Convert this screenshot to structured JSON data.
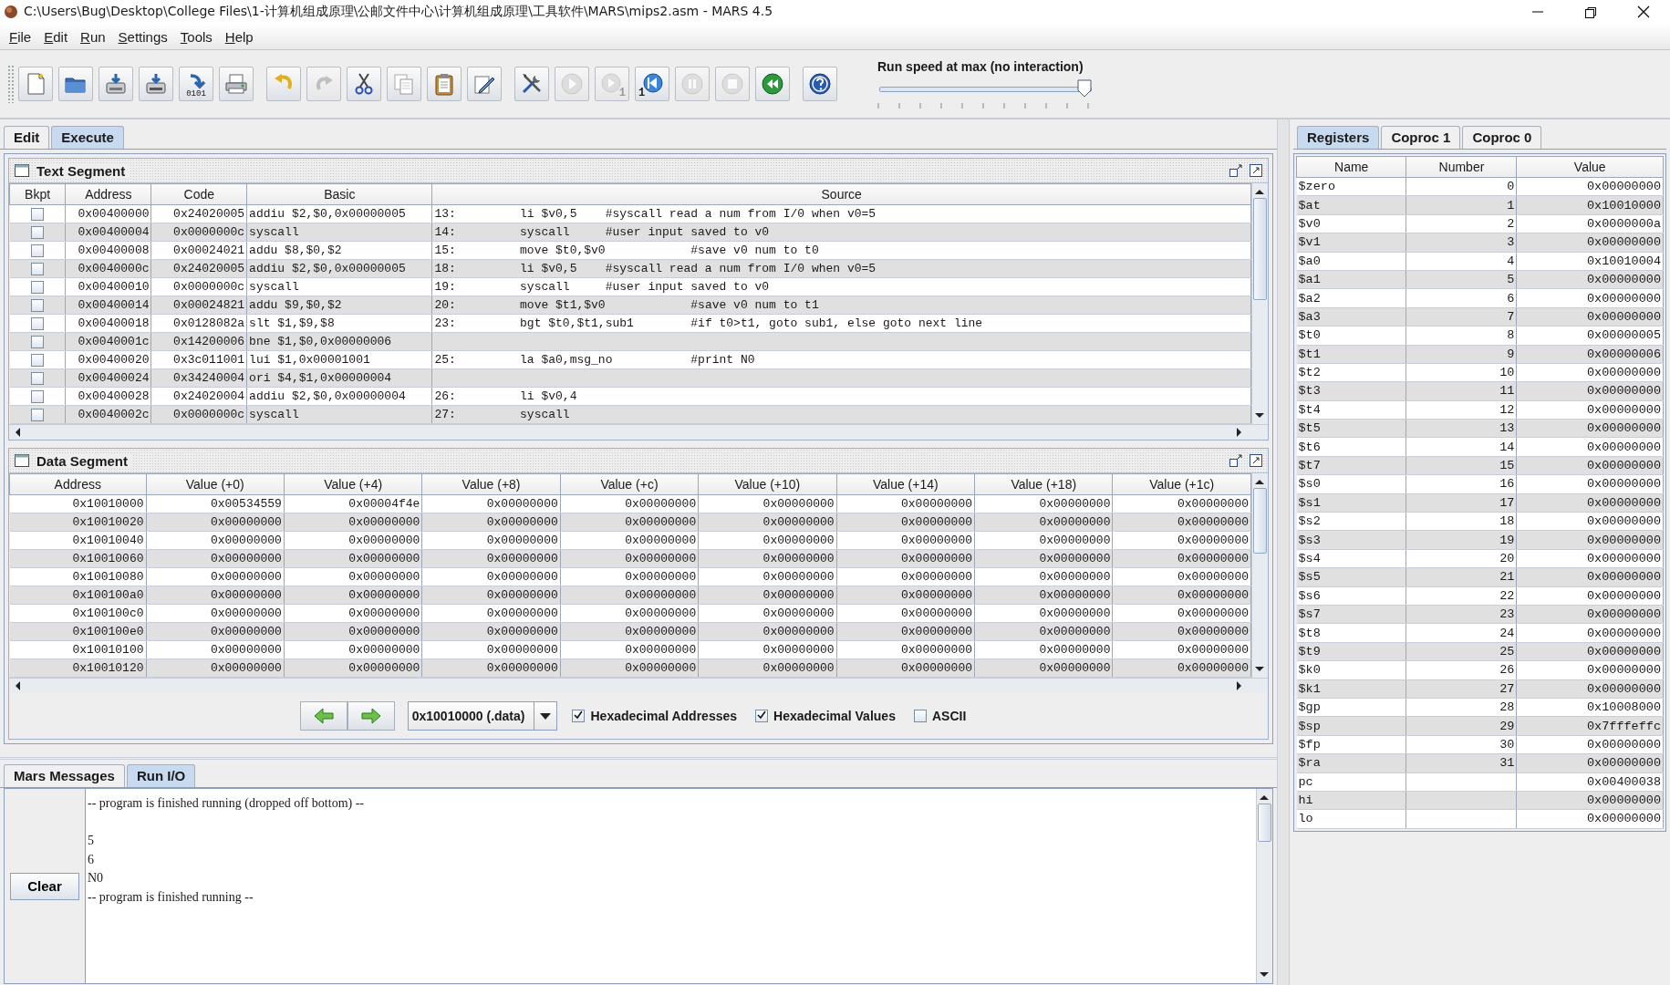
{
  "window": {
    "title": "C:\\Users\\Bug\\Desktop\\College Files\\1-计算机组成原理\\公邮文件中心\\计算机组成原理\\工具软件\\MARS\\mips2.asm  - MARS 4.5"
  },
  "menu": [
    "File",
    "Edit",
    "Run",
    "Settings",
    "Tools",
    "Help"
  ],
  "toolbar": [
    [
      {
        "kind": "new",
        "disabled": false
      },
      {
        "kind": "open",
        "disabled": false
      },
      {
        "kind": "save",
        "disabled": false
      },
      {
        "kind": "save_as",
        "disabled": false
      },
      {
        "kind": "dump",
        "disabled": false,
        "badge": "0101"
      },
      {
        "kind": "print",
        "disabled": false
      }
    ],
    [
      {
        "kind": "undo",
        "disabled": false
      },
      {
        "kind": "redo",
        "disabled": true
      },
      {
        "kind": "cut",
        "disabled": false
      },
      {
        "kind": "copy",
        "disabled": false
      },
      {
        "kind": "paste",
        "disabled": false
      },
      {
        "kind": "find",
        "disabled": false
      }
    ],
    [
      {
        "kind": "assemble",
        "disabled": false
      },
      {
        "kind": "run",
        "disabled": true
      },
      {
        "kind": "step",
        "disabled": true,
        "badge": "1"
      },
      {
        "kind": "backstep",
        "disabled": false,
        "badge": "1"
      },
      {
        "kind": "pause",
        "disabled": true
      },
      {
        "kind": "stop",
        "disabled": true
      },
      {
        "kind": "reset",
        "disabled": false
      }
    ],
    [
      {
        "kind": "help",
        "disabled": false
      }
    ]
  ],
  "run_speed": {
    "label": "Run speed at max (no interaction)",
    "level": 1
  },
  "main_tabs": [
    {
      "label": "Edit",
      "selected": false
    },
    {
      "label": "Execute",
      "selected": true
    }
  ],
  "text_segment": {
    "title": "Text Segment",
    "columns": [
      "Bkpt",
      "Address",
      "Code",
      "Basic",
      "Source"
    ],
    "rows": [
      {
        "bkpt": false,
        "address": "0x00400000",
        "code": "0x24020005",
        "basic": "addiu $2,$0,0x00000005",
        "source": "13:\tli $v0,5\t#syscall read a num from I/0 when v0=5"
      },
      {
        "bkpt": false,
        "address": "0x00400004",
        "code": "0x0000000c",
        "basic": "syscall",
        "source": "14:\tsyscall\t#user input saved to v0"
      },
      {
        "bkpt": false,
        "address": "0x00400008",
        "code": "0x00024021",
        "basic": "addu $8,$0,$2",
        "source": "15:\tmove $t0,$v0\t#save v0 num to t0"
      },
      {
        "bkpt": false,
        "address": "0x0040000c",
        "code": "0x24020005",
        "basic": "addiu $2,$0,0x00000005",
        "source": "18:\tli $v0,5\t#syscall read a num from I/0 when v0=5"
      },
      {
        "bkpt": false,
        "address": "0x00400010",
        "code": "0x0000000c",
        "basic": "syscall",
        "source": "19:\tsyscall\t#user input saved to v0"
      },
      {
        "bkpt": false,
        "address": "0x00400014",
        "code": "0x00024821",
        "basic": "addu $9,$0,$2",
        "source": "20:\tmove $t1,$v0\t#save v0 num to t1"
      },
      {
        "bkpt": false,
        "address": "0x00400018",
        "code": "0x0128082a",
        "basic": "slt $1,$9,$8",
        "source": "23:\tbgt $t0,$t1,sub1\t#if t0>t1, goto sub1, else goto next line"
      },
      {
        "bkpt": false,
        "address": "0x0040001c",
        "code": "0x14200006",
        "basic": "bne $1,$0,0x00000006"
      },
      {
        "bkpt": false,
        "address": "0x00400020",
        "code": "0x3c011001",
        "basic": "lui $1,0x00001001",
        "source": "25:\tla $a0,msg_no\t#print N0"
      },
      {
        "bkpt": false,
        "address": "0x00400024",
        "code": "0x34240004",
        "basic": "ori $4,$1,0x00000004"
      },
      {
        "bkpt": false,
        "address": "0x00400028",
        "code": "0x24020004",
        "basic": "addiu $2,$0,0x00000004",
        "source": "26:\tli $v0,4"
      },
      {
        "bkpt": false,
        "address": "0x0040002c",
        "code": "0x0000000c",
        "basic": "syscall",
        "source": "27:\tsyscall"
      }
    ]
  },
  "data_segment": {
    "title": "Data Segment",
    "columns": [
      "Address",
      "Value (+0)",
      "Value (+4)",
      "Value (+8)",
      "Value (+c)",
      "Value (+10)",
      "Value (+14)",
      "Value (+18)",
      "Value (+1c)"
    ],
    "rows": [
      {
        "address": "0x10010000",
        "values": [
          "0x00534559",
          "0x00004f4e",
          "0x00000000",
          "0x00000000",
          "0x00000000",
          "0x00000000",
          "0x00000000",
          "0x00000000"
        ]
      },
      {
        "address": "0x10010020",
        "values": [
          "0x00000000",
          "0x00000000",
          "0x00000000",
          "0x00000000",
          "0x00000000",
          "0x00000000",
          "0x00000000",
          "0x00000000"
        ]
      },
      {
        "address": "0x10010040",
        "values": [
          "0x00000000",
          "0x00000000",
          "0x00000000",
          "0x00000000",
          "0x00000000",
          "0x00000000",
          "0x00000000",
          "0x00000000"
        ]
      },
      {
        "address": "0x10010060",
        "values": [
          "0x00000000",
          "0x00000000",
          "0x00000000",
          "0x00000000",
          "0x00000000",
          "0x00000000",
          "0x00000000",
          "0x00000000"
        ]
      },
      {
        "address": "0x10010080",
        "values": [
          "0x00000000",
          "0x00000000",
          "0x00000000",
          "0x00000000",
          "0x00000000",
          "0x00000000",
          "0x00000000",
          "0x00000000"
        ]
      },
      {
        "address": "0x100100a0",
        "values": [
          "0x00000000",
          "0x00000000",
          "0x00000000",
          "0x00000000",
          "0x00000000",
          "0x00000000",
          "0x00000000",
          "0x00000000"
        ]
      },
      {
        "address": "0x100100c0",
        "values": [
          "0x00000000",
          "0x00000000",
          "0x00000000",
          "0x00000000",
          "0x00000000",
          "0x00000000",
          "0x00000000",
          "0x00000000"
        ]
      },
      {
        "address": "0x100100e0",
        "values": [
          "0x00000000",
          "0x00000000",
          "0x00000000",
          "0x00000000",
          "0x00000000",
          "0x00000000",
          "0x00000000",
          "0x00000000"
        ]
      },
      {
        "address": "0x10010100",
        "values": [
          "0x00000000",
          "0x00000000",
          "0x00000000",
          "0x00000000",
          "0x00000000",
          "0x00000000",
          "0x00000000",
          "0x00000000"
        ]
      },
      {
        "address": "0x10010120",
        "values": [
          "0x00000000",
          "0x00000000",
          "0x00000000",
          "0x00000000",
          "0x00000000",
          "0x00000000",
          "0x00000000",
          "0x00000000"
        ]
      }
    ],
    "address_selector": "0x10010000 (.data)",
    "options": [
      {
        "label": "Hexadecimal Addresses",
        "checked": true
      },
      {
        "label": "Hexadecimal Values",
        "checked": true
      },
      {
        "label": "ASCII",
        "checked": false
      }
    ]
  },
  "io_tabs": [
    {
      "label": "Mars Messages",
      "selected": false
    },
    {
      "label": "Run I/O",
      "selected": true
    }
  ],
  "clear_button": "Clear",
  "output": "-- program is finished running (dropped off bottom) --\n\n5\n6\nN0\n-- program is finished running --",
  "register_tabs": [
    {
      "label": "Registers",
      "selected": true
    },
    {
      "label": "Coproc 1",
      "selected": false
    },
    {
      "label": "Coproc 0",
      "selected": false
    }
  ],
  "registers": {
    "columns": [
      "Name",
      "Number",
      "Value"
    ],
    "rows": [
      {
        "name": "$zero",
        "number": "0",
        "value": "0x00000000"
      },
      {
        "name": "$at",
        "number": "1",
        "value": "0x10010000"
      },
      {
        "name": "$v0",
        "number": "2",
        "value": "0x0000000a"
      },
      {
        "name": "$v1",
        "number": "3",
        "value": "0x00000000"
      },
      {
        "name": "$a0",
        "number": "4",
        "value": "0x10010004"
      },
      {
        "name": "$a1",
        "number": "5",
        "value": "0x00000000"
      },
      {
        "name": "$a2",
        "number": "6",
        "value": "0x00000000"
      },
      {
        "name": "$a3",
        "number": "7",
        "value": "0x00000000"
      },
      {
        "name": "$t0",
        "number": "8",
        "value": "0x00000005"
      },
      {
        "name": "$t1",
        "number": "9",
        "value": "0x00000006"
      },
      {
        "name": "$t2",
        "number": "10",
        "value": "0x00000000"
      },
      {
        "name": "$t3",
        "number": "11",
        "value": "0x00000000"
      },
      {
        "name": "$t4",
        "number": "12",
        "value": "0x00000000"
      },
      {
        "name": "$t5",
        "number": "13",
        "value": "0x00000000"
      },
      {
        "name": "$t6",
        "number": "14",
        "value": "0x00000000"
      },
      {
        "name": "$t7",
        "number": "15",
        "value": "0x00000000"
      },
      {
        "name": "$s0",
        "number": "16",
        "value": "0x00000000"
      },
      {
        "name": "$s1",
        "number": "17",
        "value": "0x00000000"
      },
      {
        "name": "$s2",
        "number": "18",
        "value": "0x00000000"
      },
      {
        "name": "$s3",
        "number": "19",
        "value": "0x00000000"
      },
      {
        "name": "$s4",
        "number": "20",
        "value": "0x00000000"
      },
      {
        "name": "$s5",
        "number": "21",
        "value": "0x00000000"
      },
      {
        "name": "$s6",
        "number": "22",
        "value": "0x00000000"
      },
      {
        "name": "$s7",
        "number": "23",
        "value": "0x00000000"
      },
      {
        "name": "$t8",
        "number": "24",
        "value": "0x00000000"
      },
      {
        "name": "$t9",
        "number": "25",
        "value": "0x00000000"
      },
      {
        "name": "$k0",
        "number": "26",
        "value": "0x00000000"
      },
      {
        "name": "$k1",
        "number": "27",
        "value": "0x00000000"
      },
      {
        "name": "$gp",
        "number": "28",
        "value": "0x10008000"
      },
      {
        "name": "$sp",
        "number": "29",
        "value": "0x7fffeffc"
      },
      {
        "name": "$fp",
        "number": "30",
        "value": "0x00000000"
      },
      {
        "name": "$ra",
        "number": "31",
        "value": "0x00000000"
      },
      {
        "name": "pc",
        "value": "0x00400038"
      },
      {
        "name": "hi",
        "value": "0x00000000"
      },
      {
        "name": "lo",
        "value": "0x00000000"
      }
    ]
  }
}
